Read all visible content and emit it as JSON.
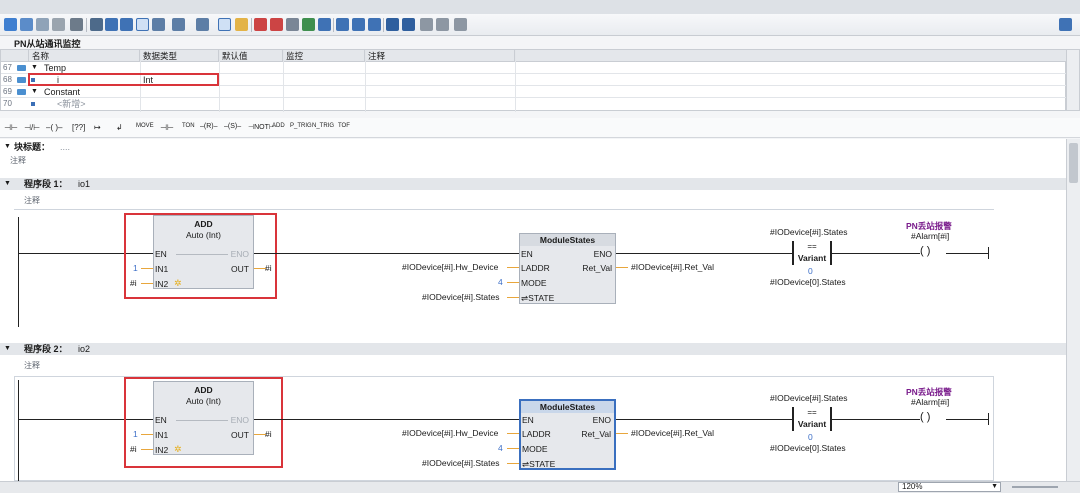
{
  "interface": {
    "title": "PN从站通讯监控",
    "columns": [
      "名称",
      "数据类型",
      "默认值",
      "监控",
      "注释"
    ],
    "rows": [
      {
        "num": "67",
        "name": "Temp",
        "type": ""
      },
      {
        "num": "68",
        "name": "i",
        "type": "Int"
      },
      {
        "num": "69",
        "name": "Constant",
        "type": ""
      },
      {
        "num": "70",
        "name": "<新增>",
        "type": ""
      }
    ]
  },
  "instructions": [
    "MOVE",
    "TON",
    "ADD",
    "P_TRIG",
    "N_TRIG",
    "TOF"
  ],
  "block_title": {
    "label": "块标题：",
    "value": "....",
    "comment": "注释"
  },
  "networks": [
    {
      "label": "程序段 1：",
      "name": "io1",
      "comment": "注释",
      "add": {
        "title": "ADD",
        "subtitle": "Auto (Int)",
        "en": "EN",
        "eno": "ENO",
        "in1": "IN1",
        "in2": "IN2",
        "out": "OUT",
        "in1_val": "1",
        "in2_val": "#i",
        "out_val": "#i"
      },
      "ms": {
        "title": "ModuleStates",
        "en": "EN",
        "eno": "ENO",
        "laddr": "LADDR",
        "mode": "MODE",
        "state": "⇌STATE",
        "ret": "Ret_Val",
        "laddr_val": "#IODevice[#i].Hw_Device",
        "mode_val": "4",
        "state_val": "#IODevice[#i].States",
        "ret_val": "#IODevice[#i].Ret_Val"
      },
      "cmp": {
        "top": "#IODevice[#i].States",
        "op": "==",
        "type": "Variant",
        "bottom_val": "0",
        "bottom": "#IODevice[0].States"
      },
      "coil": {
        "title": "PN丢站报警",
        "operand": "#Alarm[#i]",
        "symbol": "( )"
      }
    },
    {
      "label": "程序段 2：",
      "name": "io2",
      "comment": "注释",
      "add": {
        "title": "ADD",
        "subtitle": "Auto (Int)",
        "en": "EN",
        "eno": "ENO",
        "in1": "IN1",
        "in2": "IN2",
        "out": "OUT",
        "in1_val": "1",
        "in2_val": "#i",
        "out_val": "#i"
      },
      "ms": {
        "title": "ModuleStates",
        "en": "EN",
        "eno": "ENO",
        "laddr": "LADDR",
        "mode": "MODE",
        "state": "⇌STATE",
        "ret": "Ret_Val",
        "laddr_val": "#IODevice[#i].Hw_Device",
        "mode_val": "4",
        "state_val": "#IODevice[#i].States",
        "ret_val": "#IODevice[#i].Ret_Val"
      },
      "cmp": {
        "top": "#IODevice[#i].States",
        "op": "==",
        "type": "Variant",
        "bottom_val": "0",
        "bottom": "#IODevice[0].States"
      },
      "coil": {
        "title": "PN丢站报警",
        "operand": "#Alarm[#i]",
        "symbol": "( )"
      }
    }
  ],
  "status": {
    "zoom": "120%"
  },
  "colors": {
    "accent_red": "#d9343a",
    "wire": "#222222",
    "value_blue": "#3d6fc7",
    "coil_purple": "#7a1c8c",
    "pin_orange": "#e8a63c"
  }
}
